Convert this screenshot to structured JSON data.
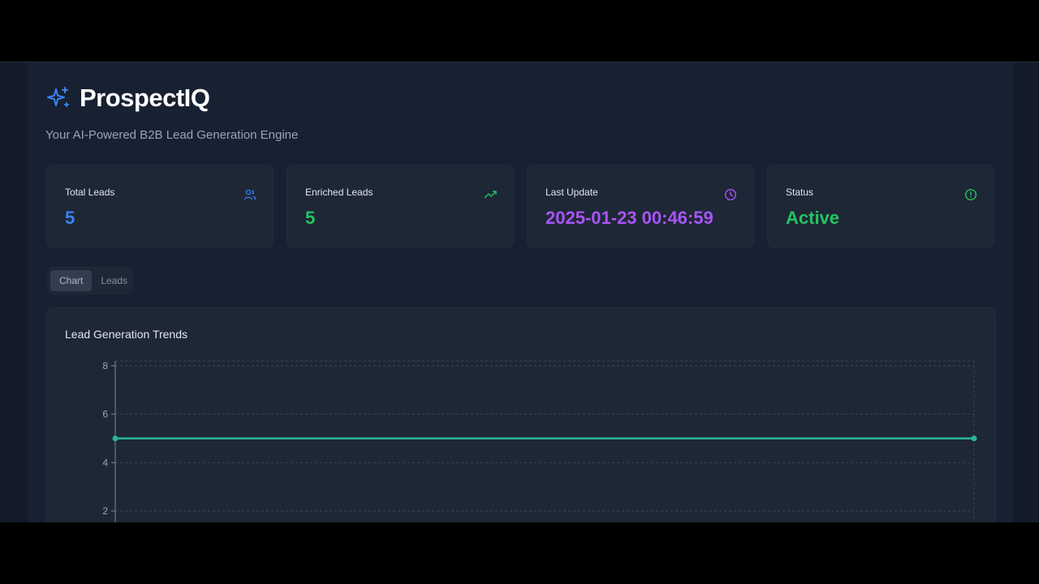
{
  "app": {
    "title": "ProspectIQ",
    "subtitle": "Your AI-Powered B2B Lead Generation Engine"
  },
  "stats": [
    {
      "label": "Total Leads",
      "value": "5",
      "icon": "users-icon",
      "color": "#3b82f6"
    },
    {
      "label": "Enriched Leads",
      "value": "5",
      "icon": "trending-up-icon",
      "color": "#22c55e"
    },
    {
      "label": "Last Update",
      "value": "2025-01-23 00:46:59",
      "icon": "clock-icon",
      "color": "#a855f7"
    },
    {
      "label": "Status",
      "value": "Active",
      "icon": "alert-circle-icon",
      "color": "#22c55e"
    }
  ],
  "tabs": [
    {
      "label": "Chart",
      "active": true
    },
    {
      "label": "Leads",
      "active": false
    }
  ],
  "chart": {
    "title": "Lead Generation Trends"
  },
  "chart_data": {
    "type": "line",
    "title": "Lead Generation Trends",
    "series": [
      {
        "values": [
          5,
          5
        ],
        "color": "#2bb596"
      }
    ],
    "x": [
      0,
      1
    ],
    "yticks": [
      2,
      4,
      6,
      8
    ],
    "ylim": [
      0,
      8
    ],
    "grid": true
  },
  "colors": {
    "accent": "#3b82f6",
    "line": "#2bb596"
  }
}
